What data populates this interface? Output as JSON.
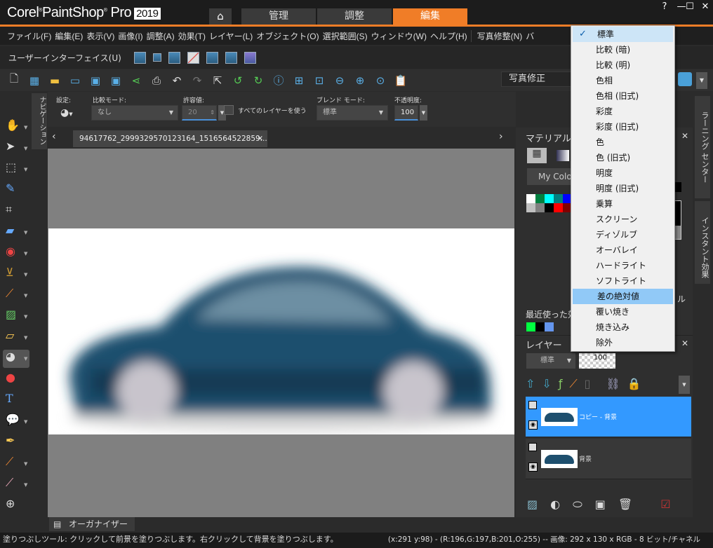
{
  "app": {
    "brand": "Corel PaintShop Pro",
    "year": "2019",
    "accent": "#f07d27"
  },
  "workspace_tabs": [
    {
      "label": "管理",
      "active": false
    },
    {
      "label": "調整",
      "active": false
    },
    {
      "label": "編集",
      "active": true
    }
  ],
  "window_controls": {
    "help": "?",
    "minimize": "—",
    "maximize": "☐",
    "close": "✕"
  },
  "menu": [
    "ファイル(F)",
    "編集(E)",
    "表示(V)",
    "画像(I)",
    "調整(A)",
    "効果(T)",
    "レイヤー(L)",
    "オブジェクト(O)",
    "選択範囲(S)",
    "ウィンドウ(W)",
    "ヘルプ(H)",
    "写真修整(N)",
    "バ"
  ],
  "ui_bar": {
    "label": "ユーザーインターフェイス(U)"
  },
  "toolbar": {
    "photo_fix": "写真修正"
  },
  "tool_options": {
    "preset_label": "設定:",
    "match_mode_label": "比較モード:",
    "match_mode_value": "なし",
    "tolerance_label": "許容値:",
    "tolerance_value": "20",
    "all_layers_label": "すべてのレイヤーを使う",
    "all_layers_checked": false,
    "blend_mode_label": "ブレンド モード:",
    "blend_mode_value": "標準",
    "opacity_label": "不透明度:",
    "opacity_value": "100"
  },
  "navigation_tab": "ナビゲーション",
  "document": {
    "tab": "94617762_2999329570123164_1516564522859...",
    "close": "✕"
  },
  "materials": {
    "title": "マテリアル",
    "close": "✕",
    "palette_button": "My Color",
    "recent_label": "最近使った効",
    "partial_label": "ル",
    "swatches": [
      "#ffffff",
      "#008040",
      "#00ffff",
      "#008080",
      "#0000ff",
      "#c0c0c0",
      "#808080",
      "#000000",
      "#ff0000",
      "#800000"
    ],
    "recent_swatches": [
      "#00ff40",
      "#000000",
      "#6495ed"
    ]
  },
  "blend_menu": {
    "selected": "標準",
    "highlighted": "差の絶対値",
    "items": [
      "標準",
      "比較 (暗)",
      "比較 (明)",
      "色相",
      "色相 (旧式)",
      "彩度",
      "彩度 (旧式)",
      "色",
      "色 (旧式)",
      "明度",
      "明度 (旧式)",
      "乗算",
      "スクリーン",
      "ディゾルブ",
      "オーバレイ",
      "ハードライト",
      "ソフトライト",
      "差の絶対値",
      "覆い焼き",
      "焼き込み",
      "除外"
    ]
  },
  "layers": {
    "title": "レイヤー",
    "close": "✕",
    "blend": "標準",
    "opacity": "100",
    "items": [
      {
        "name": "コピー - 背景",
        "selected": true
      },
      {
        "name": "背景",
        "selected": false
      }
    ]
  },
  "right_tabs": [
    "ラーニング センター",
    "インスタント効果"
  ],
  "organizer": "オーガナイザー",
  "status": {
    "message": "塗りつぶしツール: クリックして前景を塗りつぶします。右クリックして背景を塗りつぶします。",
    "info": "(x:291 y:98) - (R:196,G:197,B:201,O:255) -- 画像:  292 x 130 x RGB - 8 ビット/チャネル"
  }
}
